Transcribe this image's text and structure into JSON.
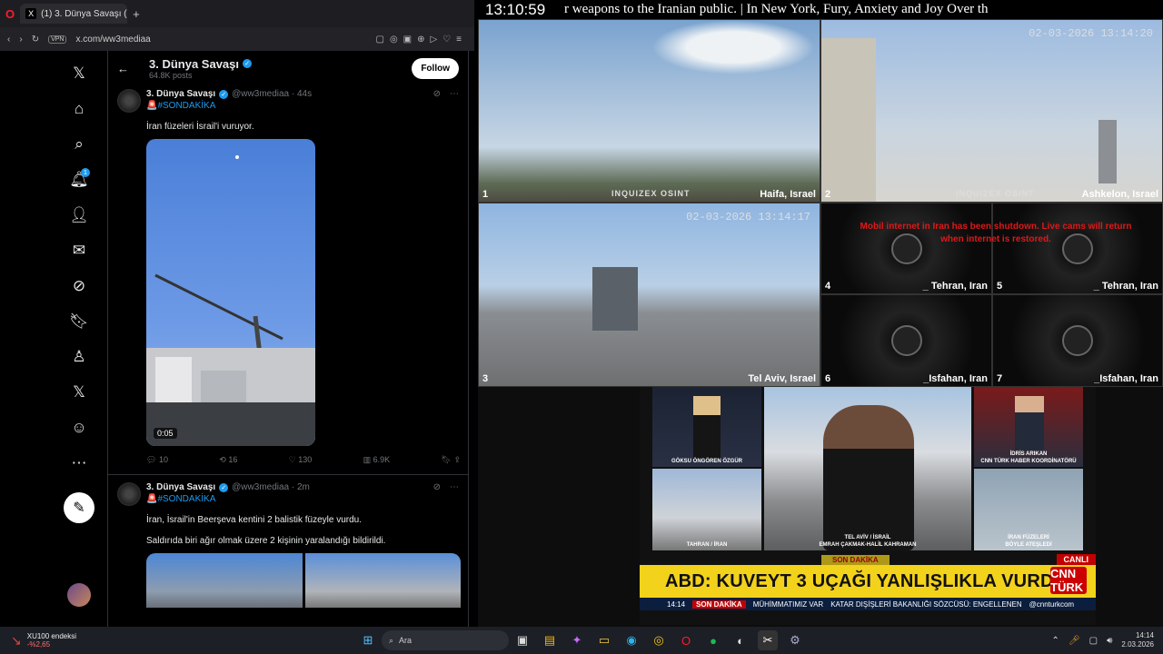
{
  "browser": {
    "tab_title": "(1) 3. Dünya Savaşı (@ww",
    "url": "x.com/ww3mediaa",
    "vpn": "VPN"
  },
  "x": {
    "nav": [
      {
        "name": "x-logo-icon",
        "glyph": "𝕏"
      },
      {
        "name": "home-icon",
        "glyph": "⌂"
      },
      {
        "name": "search-icon",
        "glyph": "⌕"
      },
      {
        "name": "notifications-icon",
        "glyph": "🔔︎"
      },
      {
        "name": "follow-icon",
        "glyph": "👤︎"
      },
      {
        "name": "messages-icon",
        "glyph": "✉"
      },
      {
        "name": "grok-icon",
        "glyph": "⊘"
      },
      {
        "name": "bookmarks-icon",
        "glyph": "🔖︎"
      },
      {
        "name": "jobs-icon",
        "glyph": "♙"
      },
      {
        "name": "premium-icon",
        "glyph": "𝕏"
      },
      {
        "name": "profile-icon",
        "glyph": "☺"
      },
      {
        "name": "more-icon",
        "glyph": "⋯"
      }
    ],
    "notif_count": "1",
    "header": {
      "name": "3. Dünya Savaşı",
      "posts": "64.8K posts",
      "follow": "Follow"
    },
    "posts": [
      {
        "name": "3. Dünya Savaşı",
        "handle": "@ww3mediaa · 44s",
        "tag": "🚨#SONDAKİKA",
        "text": "İran füzeleri İsrail'i vuruyor.",
        "video_time": "0:05",
        "replies": "10",
        "reposts": "16",
        "likes": "130",
        "views": "6.9K"
      },
      {
        "name": "3. Dünya Savaşı",
        "handle": "@ww3mediaa · 2m",
        "tag": "🚨#SONDAKİKA",
        "text": "İran, İsrail'in Beerşeva kentini 2 balistik füzeyle vurdu.",
        "text2": "Saldırıda biri ağır olmak üzere 2 kişinin yaralandığı bildirildi."
      }
    ]
  },
  "stream": {
    "clock": "13:10:59",
    "ticker": "r weapons to the Iranian public.   |   In New York, Fury, Anxiety and Joy Over th",
    "watermark": "INQUIZEX OSINT",
    "cams": [
      {
        "num": "1",
        "label": "Haifa, Israel"
      },
      {
        "num": "2",
        "label": "Ashkelon, Israel",
        "ts": "02-03-2026 13:14:20"
      },
      {
        "num": "3",
        "label": "Tel Aviv, Israel",
        "ts": "02-03-2026 13:14:17"
      },
      {
        "num": "4",
        "label": "_ Tehran, Iran"
      },
      {
        "num": "5",
        "label": "_ Tehran, Iran"
      },
      {
        "num": "6",
        "label": "_Isfahan, Iran"
      },
      {
        "num": "7",
        "label": "_Isfahan, Iran"
      }
    ],
    "internet_msg": "Mobil internet in Iran has been shutdown. Live cams will return when internet is restored."
  },
  "cnn": {
    "pane_caps": {
      "anchor": "GÖKSU ÖNGÖREN ÖZGÜR",
      "guest": "İDRİS ARIKAN\nCNN TÜRK HABER KOORDİNATÖRÜ",
      "tahran": "TAHRAN / İRAN",
      "reporter": "TEL AVİV / İSRAİL\nEMRAH ÇAKMAK-HALİL KAHRAMAN",
      "missiles": "İRAN FÜZELERİ\nBÖYLE ATEŞLEDİ"
    },
    "son_dakika": "SON DAKİKA",
    "canli": "CANLI",
    "headline": "ABD: KUVEYT 3 UÇAĞI YANLIŞLIKLA VURDU",
    "logo": "CNN TÜRK",
    "crawl": {
      "time": "14:14",
      "label": "SON DAKİKA",
      "text1": "MÜHİMMATIMIZ VAR",
      "text2": "KATAR DIŞİŞLERİ BAKANLIĞI SÖZCÜSÜ: ENGELLENEN",
      "handle": "@cnnturkcom"
    }
  },
  "taskbar": {
    "widget_title": "XU100 endeksi",
    "widget_value": "-%2,65",
    "search": "Ara",
    "time": "14:14",
    "date": "2.03.2026"
  }
}
